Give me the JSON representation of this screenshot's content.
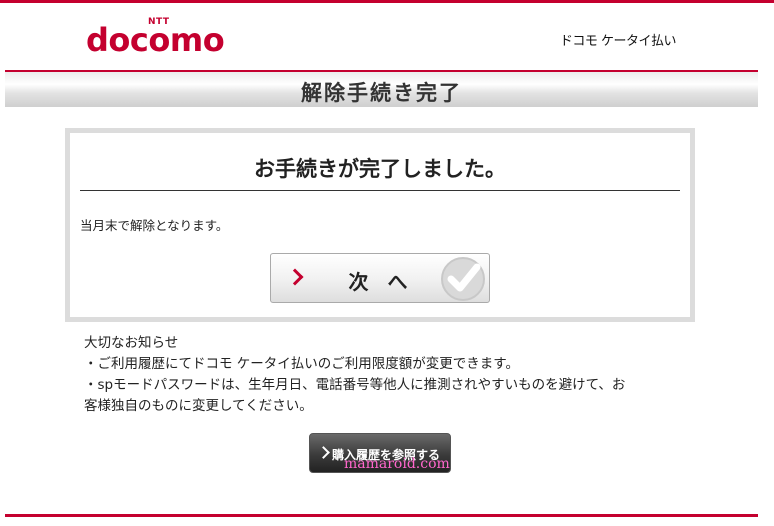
{
  "header": {
    "brand_small": "NTT",
    "brand": "docomo",
    "service_name": "ドコモ ケータイ払い"
  },
  "title_bar": {
    "title": "解除手続き完了"
  },
  "panel": {
    "heading": "お手続きが完了しました。",
    "message": "当月末で解除となります。",
    "next_button_label": "次 へ"
  },
  "notice": {
    "heading": "大切なお知らせ",
    "items": [
      "・ご利用履歴にてドコモ ケータイ払いのご利用限度額が変更できます。",
      "・spモードパスワードは、生年月日、電話番号等他人に推測されやすいものを避けて、お",
      "客様独自のものに変更してください。"
    ]
  },
  "history_button_label": "購入履歴を参照する",
  "watermark": "mamaroid.com",
  "colors": {
    "brand_red": "#c4002f",
    "watermark_pink": "#ff66cc"
  },
  "icons": [
    "chevron-right-icon",
    "checkmark-icon"
  ]
}
